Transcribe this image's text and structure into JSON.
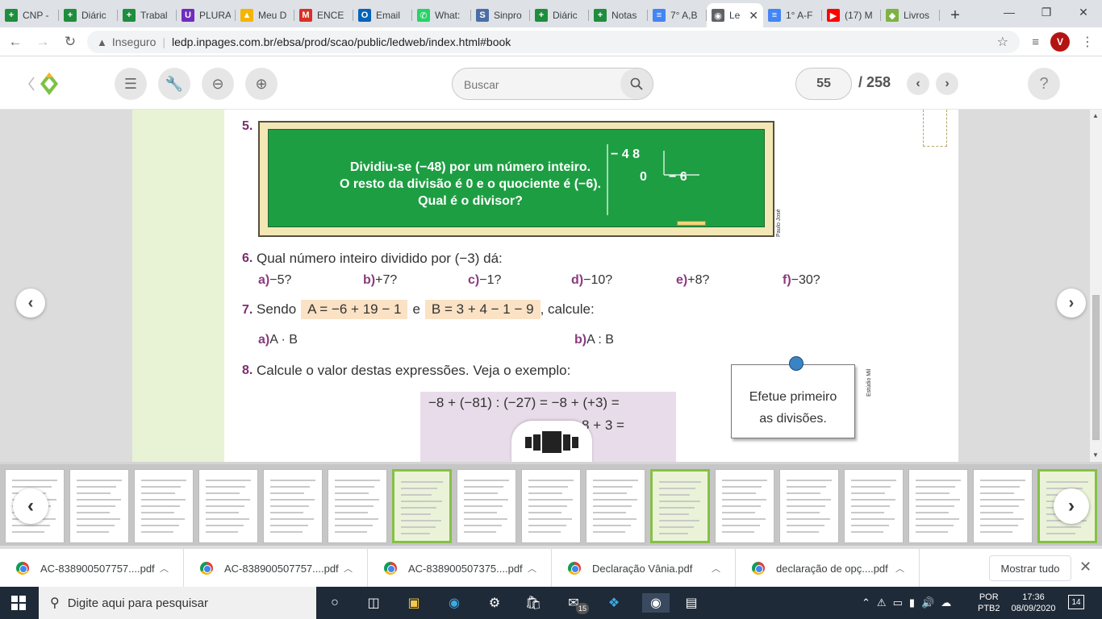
{
  "browser": {
    "tabs": [
      {
        "label": "CNP -",
        "icon": "plus-icon",
        "color": "#1e8e3e"
      },
      {
        "label": "Diáric",
        "icon": "plus-icon",
        "color": "#1e8e3e"
      },
      {
        "label": "Trabal",
        "icon": "plus-icon",
        "color": "#1e8e3e"
      },
      {
        "label": "PLURA",
        "icon": "u-icon",
        "color": "#6f2dbd"
      },
      {
        "label": "Meu D",
        "icon": "drive-icon",
        "color": "#f4b400"
      },
      {
        "label": "ENCE",
        "icon": "gmail-icon",
        "color": "#d93025"
      },
      {
        "label": "Email",
        "icon": "outlook-icon",
        "color": "#0364b8"
      },
      {
        "label": "What:",
        "icon": "whatsapp-icon",
        "color": "#25d366"
      },
      {
        "label": "Sinpro",
        "icon": "s-icon",
        "color": "#4a6fa5"
      },
      {
        "label": "Diáric",
        "icon": "plus-icon",
        "color": "#1e8e3e"
      },
      {
        "label": "Notas",
        "icon": "plus-icon",
        "color": "#1e8e3e"
      },
      {
        "label": "7° A,B",
        "icon": "doc-icon",
        "color": "#4285f4"
      },
      {
        "label": "Le",
        "icon": "globe-icon",
        "color": "#5f6368",
        "active": true
      },
      {
        "label": "1° A-F",
        "icon": "doc-icon",
        "color": "#4285f4"
      },
      {
        "label": "(17) M",
        "icon": "youtube-icon",
        "color": "#ff0000"
      },
      {
        "label": "Livros",
        "icon": "diamond-icon",
        "color": "#7cb342"
      }
    ],
    "insecure_label": "Inseguro",
    "url": "ledp.inpages.com.br/ebsa/prod/scao/public/ledweb/index.html#book",
    "profile_initial": "V"
  },
  "reader": {
    "search_placeholder": "Buscar",
    "current_page": "55",
    "total_pages": "/ 258",
    "help": "?"
  },
  "page": {
    "q5": {
      "num": "5.",
      "line1": "Dividiu-se (−48) por um número inteiro.",
      "line2": "O resto da divisão é 0 e o quociente é (−6).",
      "line3": "Qual é o divisor?",
      "dividend": "− 4 8",
      "remainder": "0",
      "quotient": "− 6",
      "credit": "Paulo José"
    },
    "q6": {
      "num": "6.",
      "text": "Qual número inteiro dividido por (−3) dá:",
      "options": [
        {
          "letter": "a)",
          "value": "−5?"
        },
        {
          "letter": "b)",
          "value": "+7?"
        },
        {
          "letter": "c)",
          "value": "−1?"
        },
        {
          "letter": "d)",
          "value": "−10?"
        },
        {
          "letter": "e)",
          "value": "+8?"
        },
        {
          "letter": "f)",
          "value": "−30?"
        }
      ]
    },
    "q7": {
      "num": "7.",
      "pre": "Sendo",
      "a_expr": "A =  −6 + 19 − 1",
      "mid": "e",
      "b_expr": "B =  3 + 4 − 1 − 9",
      "post": ", calcule:",
      "a_opt": {
        "letter": "a)",
        "value": "A · B"
      },
      "b_opt": {
        "letter": "b)",
        "value": "A : B"
      }
    },
    "q8": {
      "num": "8.",
      "text": "Calcule o valor destas expressões. Veja o exemplo:",
      "example_line1": "−8 +  (−81) : (−27) = −8 +  (+3) =",
      "example_line2": "8 +  3 =",
      "note_line1": "Efetue primeiro",
      "note_line2": "as divisões.",
      "credit": "Estúdio Mil"
    }
  },
  "downloads": [
    {
      "name": "AC-838900507757....pdf"
    },
    {
      "name": "AC-838900507757....pdf"
    },
    {
      "name": "AC-838900507375....pdf"
    },
    {
      "name": "Declaração Vânia.pdf"
    },
    {
      "name": "declaração de opç....pdf"
    }
  ],
  "show_all": "Mostrar tudo",
  "taskbar": {
    "search_placeholder": "Digite aqui para pesquisar",
    "mail_badge": "15",
    "lang1": "POR",
    "lang2": "PTB2",
    "time": "17:36",
    "date": "08/09/2020",
    "notifications": "14"
  }
}
